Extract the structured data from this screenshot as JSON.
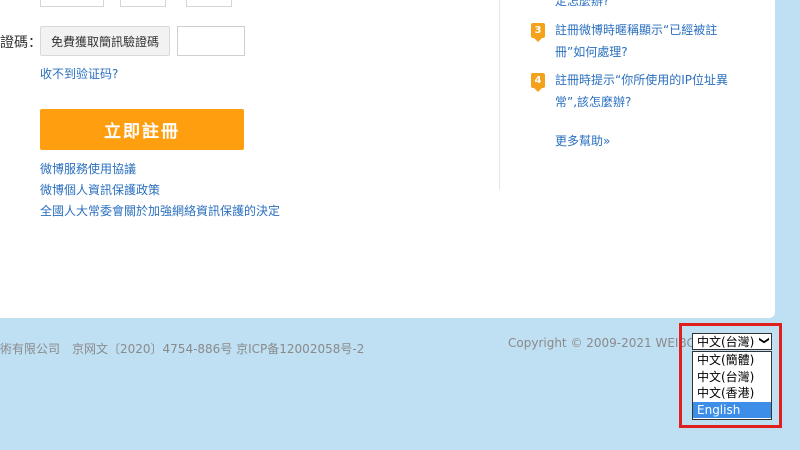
{
  "form": {
    "code_label": "證碼：",
    "sms_button": "免費獲取簡訊驗證碼",
    "no_code_link": "收不到验证码?",
    "register_button": "立即註冊",
    "links": [
      "微博服務使用協議",
      "微博個人資訊保護政策",
      "全國人大常委會關於加強網絡資訊保護的決定"
    ]
  },
  "faq": {
    "partial_top": "定怎麼辦?",
    "items": [
      {
        "num": "3",
        "line1": "註冊微博時暱稱顯示“已經被註",
        "line2": "冊”如何處理?"
      },
      {
        "num": "4",
        "line1": "註冊時提示“你所使用的IP位址異",
        "line2": "常”,該怎麼辦?"
      }
    ],
    "more_help": "更多幫助»"
  },
  "footer": {
    "company": "術有限公司",
    "license": "京网文〔2020〕4754-886号 京ICP备12002058号-2",
    "copyright": "Copyright © 2009-2021 WEIBO"
  },
  "language": {
    "selected": "中文(台灣)",
    "options": [
      "中文(簡體)",
      "中文(台灣)",
      "中文(香港)",
      "English"
    ],
    "highlighted_index": 3
  }
}
